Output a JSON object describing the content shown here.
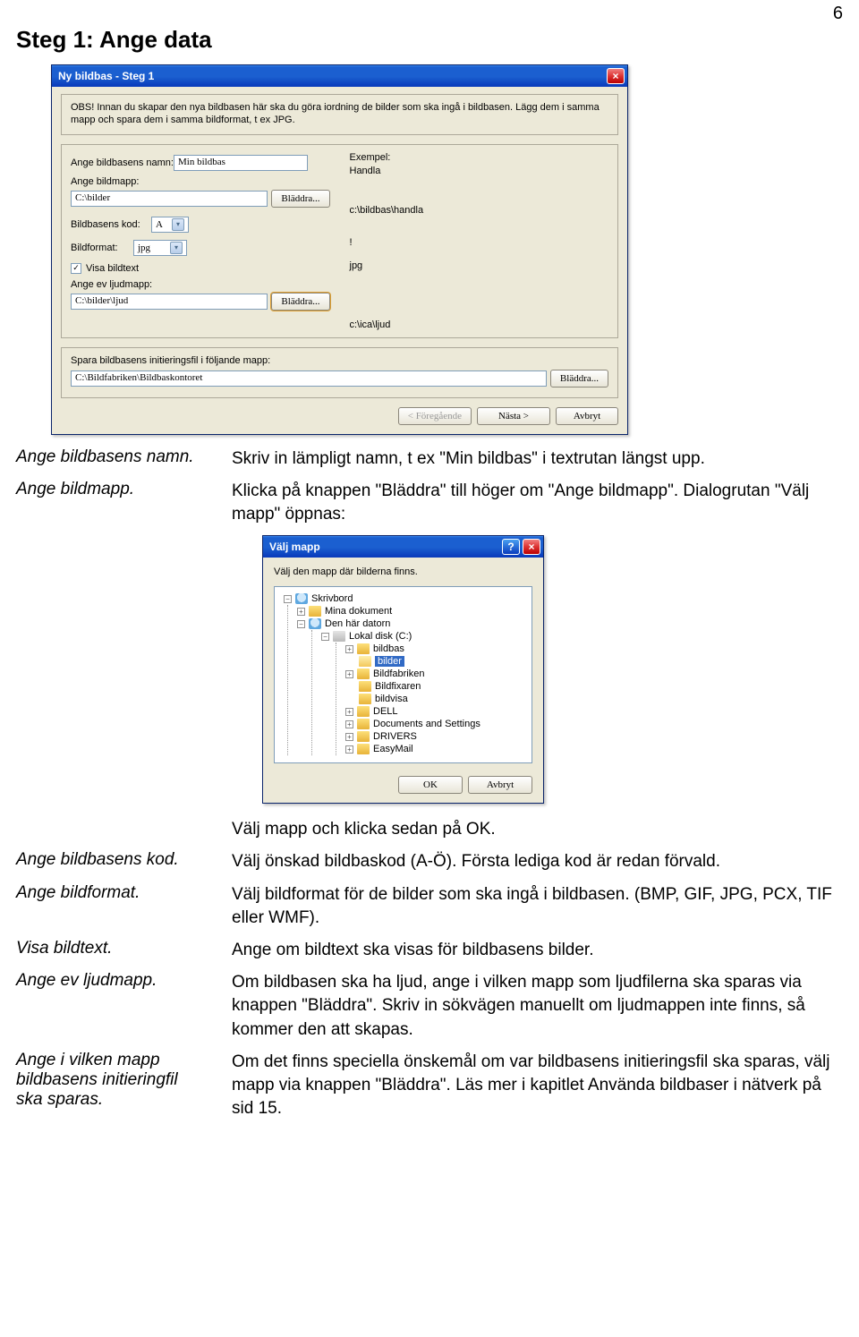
{
  "page_number": "6",
  "heading": "Steg 1: Ange data",
  "dlg1": {
    "title": "Ny bildbas - Steg 1",
    "obs": "OBS! Innan du skapar den nya bildbasen här ska du göra iordning de bilder som ska ingå i bildbasen. Lägg dem i samma mapp och spara dem i samma bildformat, t ex JPG.",
    "exempel": "Exempel:",
    "name_label": "Ange bildbasens namn:",
    "name_value": "Min bildbas",
    "name_sample": "Handla",
    "folder_label": "Ange bildmapp:",
    "folder_value": "C:\\bilder",
    "folder_sample": "c:\\bildbas\\handla",
    "code_label": "Bildbasens kod:",
    "code_value": "A",
    "code_sample": "!",
    "format_label": "Bildformat:",
    "format_value": "jpg",
    "format_sample": "jpg",
    "show_text": "Visa bildtext",
    "sound_label": "Ange ev ljudmapp:",
    "sound_value": "C:\\bilder\\ljud",
    "sound_sample": "c:\\ica\\ljud",
    "bladdra": "Bläddra...",
    "save_label": "Spara bildbasens initieringsfil i följande mapp:",
    "save_value": "C:\\Bildfabriken\\Bildbaskontoret",
    "back": "< Föregående",
    "next": "Nästa >",
    "cancel": "Avbryt"
  },
  "dlg2": {
    "title": "Välj mapp",
    "prompt": "Välj den mapp där bilderna finns.",
    "nodes": {
      "desktop": "Skrivbord",
      "mydocs": "Mina dokument",
      "computer": "Den här datorn",
      "cdrive": "Lokal disk (C:)",
      "bildbas": "bildbas",
      "bilder": "bilder",
      "bildfabriken": "Bildfabriken",
      "bildfixaren": "Bildfixaren",
      "bildvisa": "bildvisa",
      "dell": "DELL",
      "docs": "Documents and Settings",
      "drivers": "DRIVERS",
      "easymail": "EasyMail"
    },
    "ok": "OK",
    "cancel": "Avbryt"
  },
  "rows": [
    {
      "term": "Ange bildbasens namn.",
      "desc": "Skriv in lämpligt namn, t ex \"Min bildbas\" i textrutan längst upp."
    },
    {
      "term": "Ange bildmapp.",
      "desc": "Klicka på knappen \"Bläddra\" till höger om \"Ange bildmapp\". Dialogrutan \"Välj mapp\" öppnas:"
    }
  ],
  "after_folder": "Välj mapp och klicka sedan på OK.",
  "rows2": [
    {
      "term": "Ange bildbasens kod.",
      "desc": "Välj önskad bildbaskod (A-Ö). Första lediga kod är redan förvald."
    },
    {
      "term": "Ange bildformat.",
      "desc": "Välj bildformat för de bilder som ska ingå i bildbasen. (BMP, GIF, JPG, PCX, TIF eller WMF)."
    },
    {
      "term": "Visa bildtext.",
      "desc": "Ange om bildtext ska visas för bildbasens bilder."
    },
    {
      "term": "Ange ev ljudmapp.",
      "desc": "Om bildbasen ska ha ljud, ange i vilken mapp som ljudfilerna ska sparas via knappen \"Bläddra\". Skriv in sökvägen manuellt om ljudmappen inte finns, så kommer den att skapas."
    },
    {
      "term": "Ange i vilken mapp bildbasens initieringfil ska sparas.",
      "desc": "Om det finns speciella önskemål om var bildbasens initieringsfil ska sparas, välj mapp via knappen \"Bläddra\". Läs mer i kapitlet Använda bildbaser i nätverk på sid 15."
    }
  ]
}
